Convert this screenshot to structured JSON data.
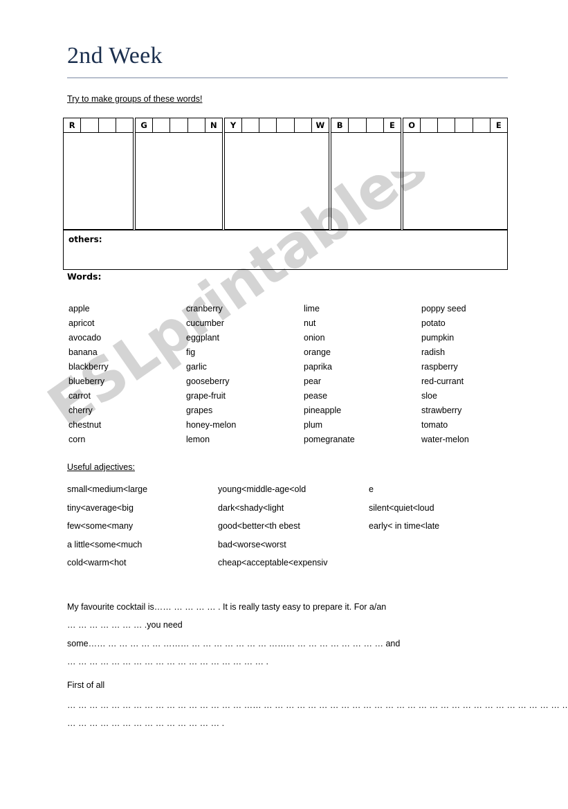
{
  "header": {
    "title": "2nd Week",
    "title_color": "#1b2f4e",
    "instruction": "Try to make groups of these words!"
  },
  "watermark": {
    "text": "ESLprintables.com",
    "color": "#c9c9c9"
  },
  "grouping_table": {
    "groups": [
      {
        "name": "red-group",
        "cells": [
          "R",
          "",
          "",
          ""
        ]
      },
      {
        "name": "green-group",
        "cells": [
          "G",
          "",
          "",
          "",
          "N"
        ]
      },
      {
        "name": "yellow-group",
        "cells": [
          "Y",
          "",
          "",
          "",
          "",
          "W"
        ]
      },
      {
        "name": "blue-group",
        "cells": [
          "B",
          "",
          "",
          "E"
        ]
      },
      {
        "name": "orange-group",
        "cells": [
          "O",
          "",
          "",
          "",
          "",
          "E"
        ]
      }
    ],
    "others_label": "others:"
  },
  "words_section": {
    "label": "Words:",
    "columns": [
      [
        "apple",
        "apricot",
        "avocado",
        "banana",
        "blackberry",
        "blueberry",
        "carrot",
        "cherry",
        "chestnut",
        "corn"
      ],
      [
        "cranberry",
        "cucumber",
        "eggplant",
        "fig",
        "garlic",
        "gooseberry",
        "grape-fruit",
        "grapes",
        "honey-melon",
        "lemon"
      ],
      [
        "lime",
        "nut",
        "onion",
        "orange",
        "paprika",
        "pear",
        "pease",
        "pineapple",
        "plum",
        "pomegranate"
      ],
      [
        "poppy seed",
        "potato",
        "pumpkin",
        "radish",
        "raspberry",
        "red-currant",
        "sloe",
        "strawberry",
        "tomato",
        "water-melon"
      ]
    ]
  },
  "adjectives_section": {
    "title": "Useful adjectives:",
    "columns": [
      [
        "small<medium<large",
        "tiny<average<big",
        "few<some<many",
        "a little<some<much",
        "cold<warm<hot"
      ],
      [
        "young<middle-age<old",
        "dark<shady<light",
        "good<better<th ebest",
        "bad<worse<worst",
        "cheap<acceptable<expensiv"
      ],
      [
        "e",
        "silent<quiet<loud",
        "early< in time<late"
      ]
    ]
  },
  "cocktail_task": {
    "line1": "My favourite cocktail is…… … … … … . It is really tasty easy to prepare it. For a/an",
    "line2": "… … … … … … … .you need",
    "fill_line1": "some…… … … … … … ……… … … … … … … … ……… … … … … … … … …  and",
    "fill_line2": "… … … … … … … … … … … … … … … … … … .",
    "first_of_all": "First of all",
    "tail_line1": "… … … … … … … … … … … … … … … … …… … … … … … … … … … … … … … … … … … … … … … … … … … … … … …",
    "tail_line2": "… … … … … … … … … … … … … … ."
  }
}
